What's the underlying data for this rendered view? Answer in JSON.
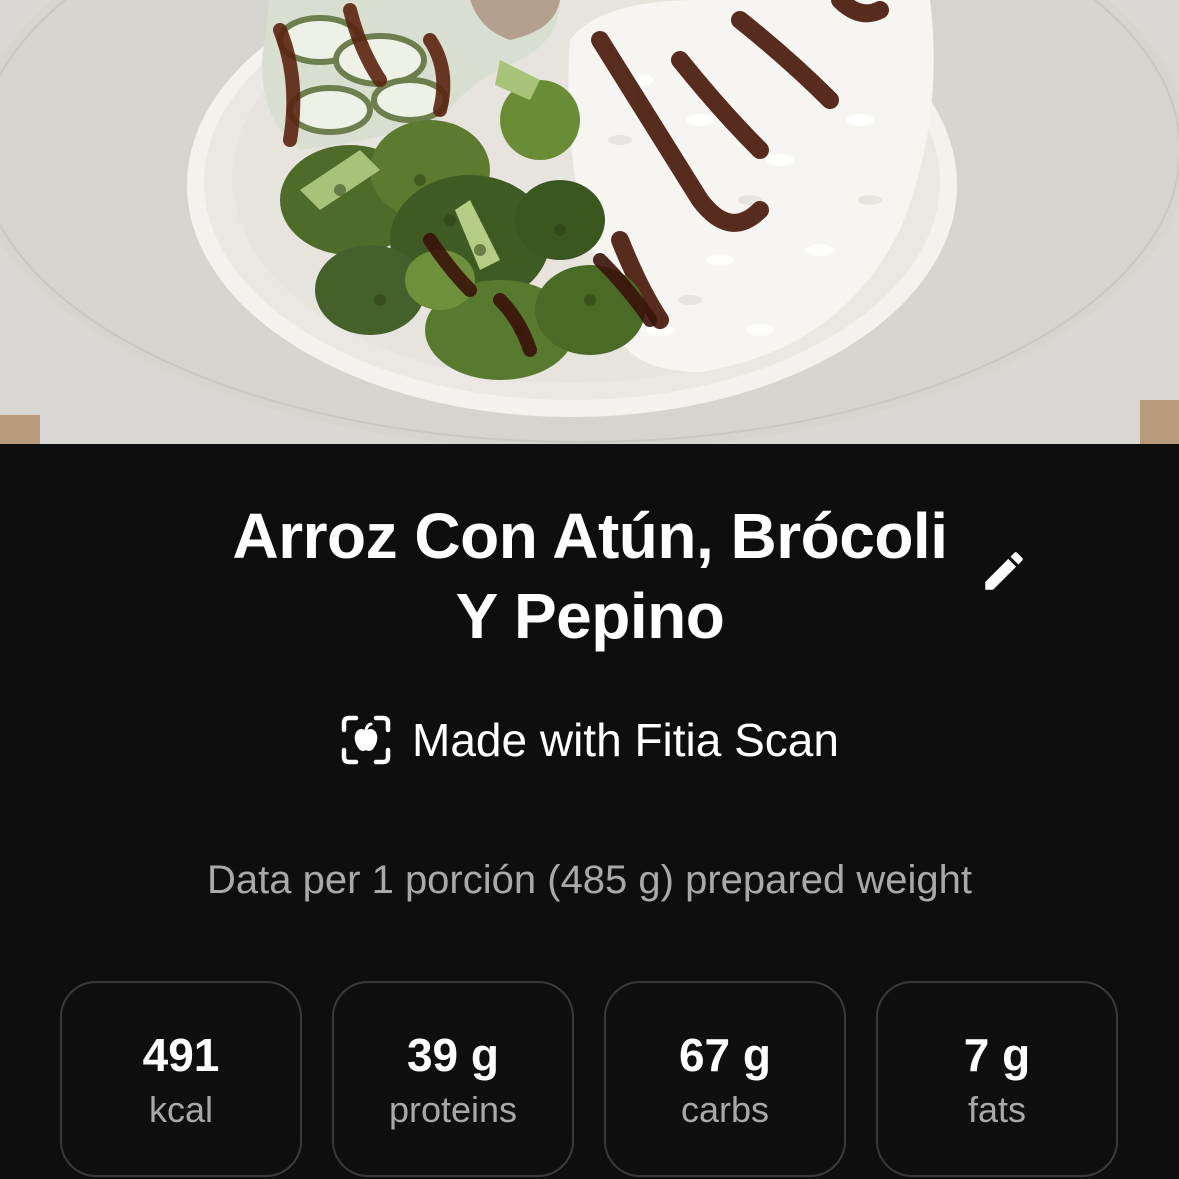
{
  "meal": {
    "title_line1": "Arroz Con Atún, Brócoli",
    "title_line2": "Y Pepino",
    "photo_icon": "food-photo"
  },
  "actions": {
    "edit_icon": "pencil-icon"
  },
  "scan_badge": {
    "icon": "scan-apple-icon",
    "text": "Made with Fitia Scan"
  },
  "serving_note": "Data per 1 porción (485 g) prepared weight",
  "macros": [
    {
      "value": "491",
      "label": "kcal"
    },
    {
      "value": "39 g",
      "label": "proteins"
    },
    {
      "value": "67 g",
      "label": "carbs"
    },
    {
      "value": "7 g",
      "label": "fats"
    }
  ],
  "colors": {
    "background": "#0e0e0e",
    "text_primary": "#ffffff",
    "text_secondary": "#a9a9ab",
    "card_border": "#3a3a3c"
  }
}
